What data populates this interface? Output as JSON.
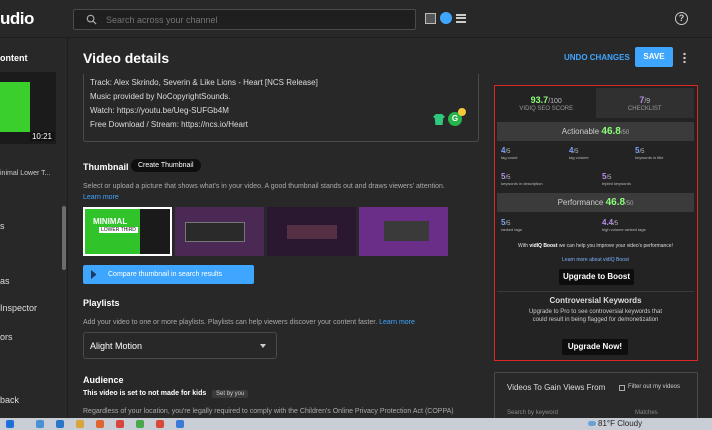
{
  "app": {
    "brand": "udio"
  },
  "search": {
    "placeholder": "Search across your channel"
  },
  "topbar": {
    "help_icon": "?"
  },
  "sidebar": {
    "title": "ontent",
    "video_duration": "10:21",
    "video_caption": "inimal Lower T...",
    "items": [
      "s",
      "as",
      "Inspector",
      "ors",
      "back"
    ]
  },
  "page": {
    "title": "Video details",
    "undo_label": "UNDO CHANGES",
    "save_label": "SAVE"
  },
  "description": {
    "lines": [
      "Track: Alex Skrindo, Severin & Like Lions - Heart [NCS Release]",
      "Music provided by NoCopyrightSounds.",
      "Watch: https://youtu.be/Ueg-SUFGb4M",
      "Free Download / Stream: https://ncs.io/Heart"
    ],
    "icon_letter": "G"
  },
  "thumbnail": {
    "heading": "Thumbnail",
    "create_label": "Create Thumbnail",
    "help": "Select or upload a picture that shows what's in your video. A good thumbnail stands out and draws viewers' attention.",
    "learn_more": "Learn more",
    "thumb1_title": "MINIMAL",
    "thumb1_sub": "LOWER THIRD",
    "compare_label": "Compare thumbnail in search results"
  },
  "playlists": {
    "heading": "Playlists",
    "help": "Add your video to one or more playlists. Playlists can help viewers discover your content faster.",
    "learn_more": "Learn more",
    "selected": "Alight Motion"
  },
  "audience": {
    "heading": "Audience",
    "status": "This video is set to not made for kids",
    "tag": "Set by you",
    "help": "Regardless of your location, you're legally required to comply with the Children's Online Privacy Protection Act (COPPA)"
  },
  "vidiq": {
    "seo_score": "93.7",
    "seo_max": "/100",
    "seo_label": "VIDIQ SEO SCORE",
    "checklist_score": "7",
    "checklist_max": "/9",
    "checklist_label": "CHECKLIST",
    "actionable_label": "Actionable",
    "actionable_value": "46.8",
    "actionable_max": "/50",
    "actionable_metrics": [
      {
        "value": "4",
        "max": "/5",
        "label": "tag count"
      },
      {
        "value": "4",
        "max": "/5",
        "label": "tag volume"
      },
      {
        "value": "5",
        "max": "/5",
        "label": "keywords in title"
      },
      {
        "value": "5",
        "max": "/5",
        "label": "keywords in description"
      },
      {
        "value": "5",
        "max": "/5",
        "label": "tripled keywords"
      }
    ],
    "performance_label": "Performance",
    "performance_value": "46.8",
    "performance_max": "/50",
    "performance_metrics": [
      {
        "value": "5",
        "max": "/5",
        "label": "ranked tags"
      },
      {
        "value": "4.4",
        "max": "/5",
        "label": "high volume ranked tags"
      }
    ],
    "boost_note_pre": "With",
    "boost_brand": "vidIQ Boost",
    "boost_note_post": "we can help you improve your video's performance!",
    "boost_learn": "Learn more about vidIQ Boost",
    "upgrade_boost": "Upgrade to Boost",
    "controversial_heading": "Controversial Keywords",
    "controversial_text": "Upgrade to Pro to see controversial keywords that could result in being flagged for demonetization",
    "upgrade_now": "Upgrade Now!"
  },
  "videos_panel": {
    "heading": "Videos To Gain Views From",
    "filter_label": "Filter out my videos",
    "keyword_placeholder": "Search by keyword",
    "matches_label": "Matches"
  },
  "taskbar": {
    "weather": "81°F  Cloudy"
  }
}
